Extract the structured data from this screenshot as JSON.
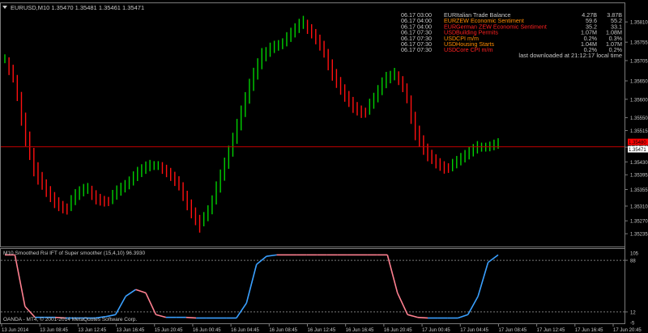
{
  "symbol_header": "EURUSD,M10  1.35470 1.35481 1.35461 1.35471",
  "colors": {
    "background": "#000000",
    "grid": "#7a7a7a",
    "bull": "#00d000",
    "bear": "#ff1010",
    "shadow": "#c8c8c8",
    "bid_line": "#c00000",
    "price_tag": "#ff0000",
    "osc_up": "#3aa0ff",
    "osc_down": "#ff8090",
    "text": "#c8c8c8"
  },
  "news": [
    {
      "time": "06.17 03:00",
      "cur": "EUR",
      "event": "Italian Trade Balance",
      "actual": "4.27B",
      "forecast": "3.87B",
      "color": "#c8c8c8"
    },
    {
      "time": "06.17 04:00",
      "cur": "EUR",
      "event": "ZEW Economic Sentiment",
      "actual": "59.6",
      "forecast": "55.2",
      "color": "#ff8c00"
    },
    {
      "time": "06.17 04:00",
      "cur": "EUR",
      "event": "German ZEW Economic Sentiment",
      "actual": "35.2",
      "forecast": "33.1",
      "color": "#ff2020"
    },
    {
      "time": "06.17 07:30",
      "cur": "USD",
      "event": "Building Permits",
      "actual": "1.07M",
      "forecast": "1.08M",
      "color": "#ff2020"
    },
    {
      "time": "06.17 07:30",
      "cur": "USD",
      "event": "CPI m/m",
      "actual": "0.2%",
      "forecast": "0.3%",
      "color": "#ff8c00"
    },
    {
      "time": "06.17 07:30",
      "cur": "USD",
      "event": "Housing Starts",
      "actual": "1.04M",
      "forecast": "1.07M",
      "color": "#ff8c00"
    },
    {
      "time": "06.17 07:30",
      "cur": "USD",
      "event": "Core CPI m/m",
      "actual": "0.2%",
      "forecast": "0.2%",
      "color": "#ff2020"
    }
  ],
  "download_note": "last downloaded at 21:12:17 local time",
  "indicator_header": "M10 Smoothed Rsi IFT of Super smoother (15,4,10) 96.3930",
  "copyright": "OANDA - MT4, © 2001-2014 MetaQuotes Software Corp.",
  "chart_data": [
    {
      "type": "line",
      "title": "EURUSD,M10",
      "ylim": [
        1.3522,
        1.3583
      ],
      "price_axis_ticks": [
        "1.35810",
        "1.35755",
        "1.35705",
        "1.35650",
        "1.35600",
        "1.35550",
        "1.35515",
        "1.35470",
        "1.35430",
        "1.35395",
        "1.35355",
        "1.35310",
        "1.35270",
        "1.35235"
      ],
      "current_price": 1.35471,
      "current_price_label": "1.35471",
      "bid_marker_label": "1.35480",
      "time_labels": [
        "13 Jun 2014",
        "13 Jun 08:45",
        "13 Jun 12:45",
        "13 Jun 16:45",
        "15 Jun 20:45",
        "16 Jun 00:45",
        "16 Jun 04:45",
        "16 Jun 08:45",
        "16 Jun 12:45",
        "16 Jun 16:45",
        "16 Jun 20:45",
        "17 Jun 00:45",
        "17 Jun 04:45",
        "17 Jun 08:45",
        "17 Jun 12:45",
        "17 Jun 16:45",
        "17 Jun 20:45"
      ],
      "series": [
        {
          "values": [
            1.3571,
            1.3566,
            1.3552,
            1.3541,
            1.3536,
            1.3532,
            1.353,
            1.3534,
            1.3536,
            1.3533,
            1.3532,
            1.3535,
            1.3537,
            1.354,
            1.3542,
            1.3542,
            1.354,
            1.3537,
            1.3531,
            1.3526,
            1.353,
            1.3538,
            1.3546,
            1.3555,
            1.3564,
            1.3571,
            1.3574,
            1.3575,
            1.3578,
            1.3581,
            1.3578,
            1.3574,
            1.3567,
            1.3562,
            1.3558,
            1.3556,
            1.356,
            1.3565,
            1.3567,
            1.3563,
            1.3552,
            1.3546,
            1.3543,
            1.3541,
            1.3543,
            1.3545,
            1.3547,
            1.3547,
            1.3548
          ]
        },
        {
          "name": "Smoothed Rsi IFT of Super smoother",
          "values": [
            96,
            96,
            20,
            4,
            4,
            4,
            3,
            3,
            3,
            3,
            5,
            8,
            35,
            45,
            40,
            8,
            4,
            4,
            4,
            3,
            3,
            3,
            3,
            3,
            25,
            82,
            94,
            96,
            96,
            96,
            96,
            96,
            96,
            96,
            96,
            96,
            96,
            96,
            96,
            40,
            8,
            4,
            3,
            3,
            3,
            3,
            8,
            35,
            85,
            96
          ],
          "ylim": [
            0,
            100
          ],
          "levels": [
            88,
            12
          ]
        }
      ]
    }
  ]
}
